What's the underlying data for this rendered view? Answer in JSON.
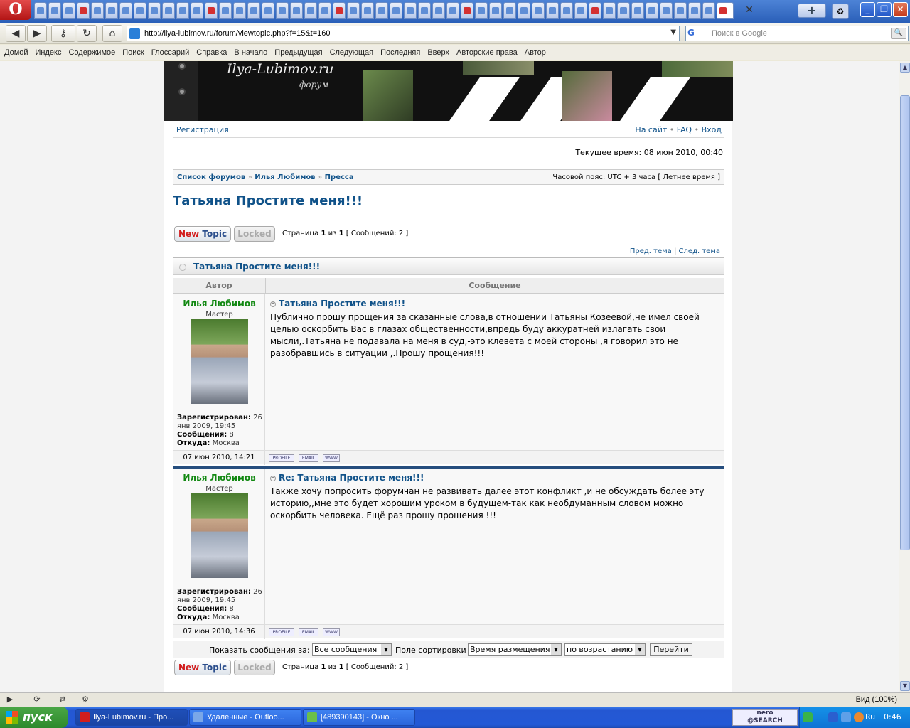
{
  "browser": {
    "opera_logo": "O",
    "address": "http://ilya-lubimov.ru/forum/viewtopic.php?f=15&t=160",
    "search_placeholder": "Поиск в Google",
    "search_engine": "G"
  },
  "linkbar": [
    "Домой",
    "Индекс",
    "Содержимое",
    "Поиск",
    "Глоссарий",
    "Справка",
    "В начало",
    "Предыдущая",
    "Следующая",
    "Последняя",
    "Вверх",
    "Авторские права",
    "Автор"
  ],
  "banner": {
    "logo": "Ilya-Lubimov.ru",
    "subtitle": "форум"
  },
  "toplinks": {
    "register": "Регистрация",
    "site": "На сайт",
    "faq": "FAQ",
    "login": "Вход",
    "bullet": "•"
  },
  "current_time": "Текущее время: 08 июн 2010, 00:40",
  "breadcrumbs": {
    "items": [
      "Список форумов",
      "Илья Любимов",
      "Пресса"
    ],
    "sep": "»",
    "timezone": "Часовой пояс: UTC + 3 часа [ Летнее время ]"
  },
  "topic": {
    "title": "Татьяна Простите меня!!!",
    "prev": "Пред. тема",
    "next": "След. тема",
    "bar": "|"
  },
  "actions": {
    "new_topic_1": "New",
    "new_topic_2": "Topic",
    "locked": "Locked",
    "page_pre": "Страница ",
    "page_num": "1",
    "page_of": " из ",
    "page_total": "1",
    "posts_count": "[ Сообщений: 2 ]"
  },
  "table": {
    "header_title": "Татьяна Простите меня!!!",
    "col_author": "Автор",
    "col_message": "Сообщение"
  },
  "posts": [
    {
      "author": "Илья Любимов",
      "rank": "Мастер",
      "reg_label": "Зарегистрирован:",
      "reg_value": "26 янв 2009, 19:45",
      "msgs_label": "Сообщения:",
      "msgs_value": "8",
      "from_label": "Откуда:",
      "from_value": "Москва",
      "title": "Татьяна Простите меня!!!",
      "body": "Публично прошу прощения за сказанные слова,в отношении Татьяны Козеевой,не имел своей целью оскорбить Вас в глазах общественности,впредь буду аккуратней излагать свои мысли,.Татьяна не подавала на меня в суд,-это клевета с моей стороны ,я говорил это не разобравшись в ситуации ,.Прошу прощения!!!",
      "date": "07 июн 2010, 14:21",
      "buttons": [
        "PROFILE",
        "EMAIL",
        "WWW"
      ]
    },
    {
      "author": "Илья Любимов",
      "rank": "Мастер",
      "reg_label": "Зарегистрирован:",
      "reg_value": "26 янв 2009, 19:45",
      "msgs_label": "Сообщения:",
      "msgs_value": "8",
      "from_label": "Откуда:",
      "from_value": "Москва",
      "title": "Re: Татьяна Простите меня!!!",
      "body": "Также хочу попросить форумчан не развивать далее этот конфликт ,и не обсуждать более эту историю,,мне это будет хорошим уроком в будущем-так как необдуманным словом можно оскорбить человека. Ещё раз прошу прощения !!!",
      "date": "07 июн 2010, 14:36",
      "buttons": [
        "PROFILE",
        "EMAIL",
        "WWW"
      ]
    }
  ],
  "display": {
    "show_label": "Показать сообщения за:",
    "show_value": "Все сообщения",
    "sort_label": "Поле сортировки",
    "sort_value": "Время размещения",
    "order_value": "по возрастанию",
    "go": "Перейти"
  },
  "statusbar": {
    "zoom": "Вид (100%)"
  },
  "taskbar": {
    "start": "пуск",
    "tasks": [
      "Ilya-Lubimov.ru - Про...",
      "Удаленные - Outloo...",
      "[489390143] - Окно ..."
    ],
    "nero_1": "nero",
    "nero_2": "@SEARCH",
    "lang": "Ru",
    "clock": "0:46"
  }
}
